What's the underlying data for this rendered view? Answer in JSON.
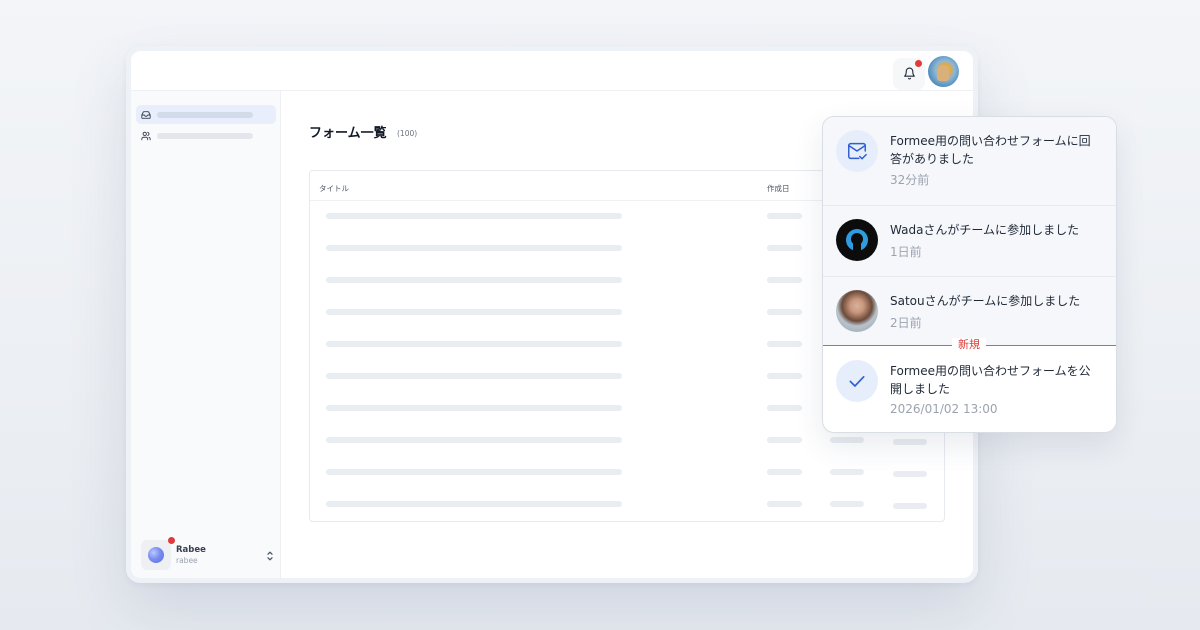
{
  "window": {
    "page_title": "フォーム一覧",
    "page_count": "(100)",
    "table": {
      "columns": [
        "タイトル",
        "作成日"
      ]
    },
    "account": {
      "name": "Rabee",
      "id": "rabee"
    }
  },
  "icons": {
    "bell": "bell-icon",
    "inbox": "inbox-icon",
    "users": "users-icon",
    "chevron": "chevron-up-down-icon",
    "mail": "mail-check-icon",
    "check": "check-icon"
  },
  "colors": {
    "accent": "#2f5fd0",
    "notification_dot": "#e23a3a",
    "new_divider": "#e05a5a"
  },
  "notifications": {
    "items": [
      {
        "text": "Formee用の問い合わせフォームに回答がありました",
        "time": "32分前"
      },
      {
        "text": "Wadaさんがチームに参加しました",
        "time": "1日前"
      },
      {
        "text": "Satouさんがチームに参加しました",
        "time": "2日前"
      },
      {
        "text": "Formee用の問い合わせフォームを公開しました",
        "time": "2026/01/02 13:00"
      }
    ],
    "new_label": "新規"
  }
}
